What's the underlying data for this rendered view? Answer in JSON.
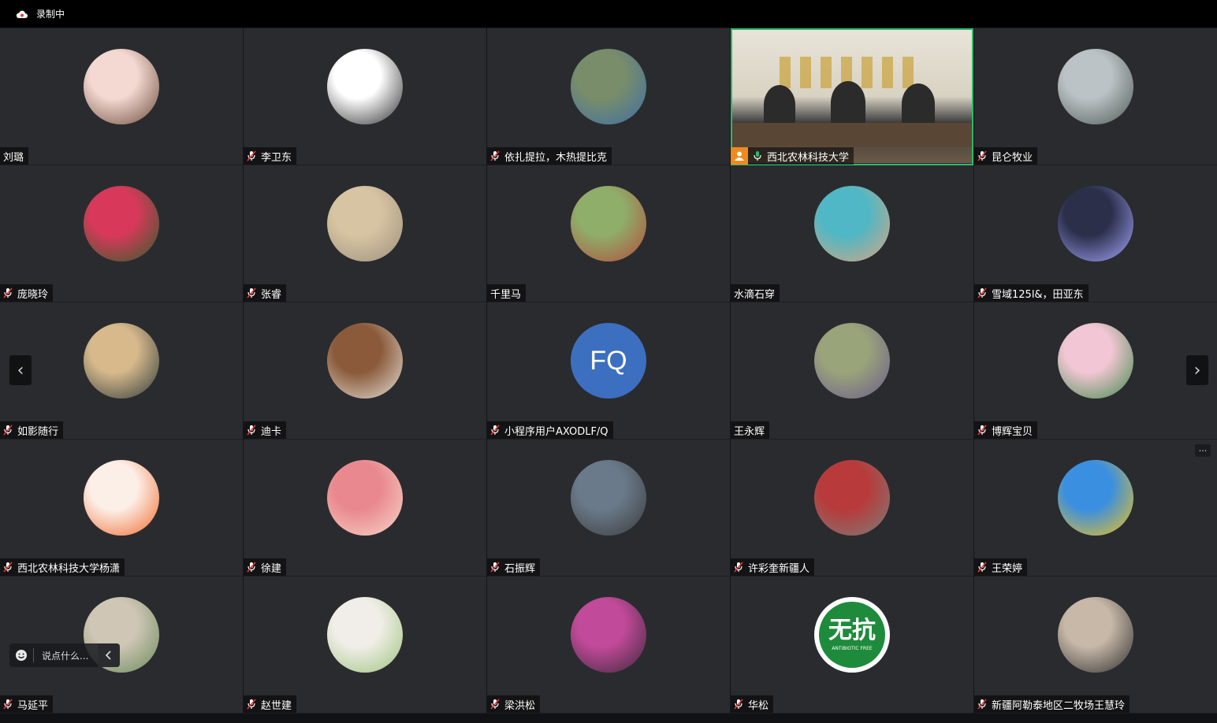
{
  "topbar": {
    "recording_label": "录制中"
  },
  "participants": [
    {
      "name": "刘璐",
      "mic": false,
      "avatar": "anime-girl-avatar",
      "colors": [
        "#f4d9d2",
        "#6b4a3a"
      ]
    },
    {
      "name": "李卫东",
      "mic": true,
      "avatar": "man-portrait-avatar",
      "colors": [
        "#ffffff",
        "#2b2b2b"
      ]
    },
    {
      "name": "依扎提拉，木热提比克",
      "mic": true,
      "avatar": "two-boys-photo-avatar",
      "colors": [
        "#7a8d6a",
        "#3d6ea5"
      ]
    },
    {
      "name": "西北农林科技大学",
      "mic": true,
      "host": true,
      "video": true,
      "avatar": "meeting-room-video"
    },
    {
      "name": "昆仑牧业",
      "mic": true,
      "avatar": "pagoda-car-photo-avatar",
      "colors": [
        "#bcc3c7",
        "#4d5a52"
      ]
    },
    {
      "name": "庞晓玲",
      "mic": true,
      "avatar": "hydrangea-photo-avatar",
      "colors": [
        "#d8395a",
        "#2f5f2a"
      ]
    },
    {
      "name": "张睿",
      "mic": true,
      "avatar": "field-photo-avatar",
      "colors": [
        "#d7c4a2",
        "#9b8f7d"
      ]
    },
    {
      "name": "千里马",
      "mic": false,
      "avatar": "garden-photo-avatar",
      "colors": [
        "#8fae6a",
        "#b34b3c"
      ]
    },
    {
      "name": "水滴石穿",
      "mic": false,
      "avatar": "seascape-photo-avatar",
      "colors": [
        "#4fb7c5",
        "#d9a57f"
      ]
    },
    {
      "name": "雪域125l&，田亚东",
      "mic": true,
      "avatar": "light-tunnel-avatar",
      "colors": [
        "#2b2f4a",
        "#a7a8ff"
      ]
    },
    {
      "name": "如影随行",
      "mic": true,
      "avatar": "sunset-lake-avatar",
      "colors": [
        "#d7b98c",
        "#2e3a3a"
      ]
    },
    {
      "name": "迪卡",
      "mic": true,
      "avatar": "horses-photo-avatar",
      "colors": [
        "#8a5a3a",
        "#e6e1d8"
      ]
    },
    {
      "name": "小程序用户AXODLF/Q",
      "mic": true,
      "initials": "FQ",
      "avatar": "initials-avatar",
      "colors": [
        "#3d6fc0",
        "#3d6fc0"
      ]
    },
    {
      "name": "王永辉",
      "mic": false,
      "avatar": "orchard-photo-avatar",
      "colors": [
        "#9aa47a",
        "#6b5c8a"
      ]
    },
    {
      "name": "博辉宝贝",
      "mic": true,
      "avatar": "blossom-photo-avatar",
      "colors": [
        "#f2c6d4",
        "#3f8a4a"
      ]
    },
    {
      "name": "西北农林科技大学杨潇",
      "mic": true,
      "avatar": "carrot-cartoon-avatar",
      "colors": [
        "#fcefe8",
        "#f06a2c"
      ]
    },
    {
      "name": "徐建",
      "mic": true,
      "avatar": "cartoon-couple-avatar",
      "colors": [
        "#e9888f",
        "#f6d7c7"
      ]
    },
    {
      "name": "石振辉",
      "mic": true,
      "avatar": "mountain-person-avatar",
      "colors": [
        "#6a7a8a",
        "#3b3b3b"
      ]
    },
    {
      "name": "许彩奎新疆人",
      "mic": true,
      "avatar": "street-banner-avatar",
      "colors": [
        "#b83a3a",
        "#7a7f7a"
      ]
    },
    {
      "name": "王荣婷",
      "mic": true,
      "avatar": "sunflower-photo-avatar",
      "colors": [
        "#3a8fe0",
        "#f2c21b"
      ]
    },
    {
      "name": "马延平",
      "mic": true,
      "avatar": "gourd-statue-avatar",
      "colors": [
        "#cfc6b6",
        "#6b8a5a"
      ]
    },
    {
      "name": "赵世建",
      "mic": true,
      "avatar": "cartoon-pig-avatar",
      "colors": [
        "#f1eee9",
        "#9cc27a"
      ]
    },
    {
      "name": "梁洪松",
      "mic": true,
      "avatar": "woman-portrait-avatar",
      "colors": [
        "#c24a9a",
        "#3a2a3a"
      ]
    },
    {
      "name": "华松",
      "mic": true,
      "avatar": "antibiotic-free-logo-avatar",
      "colors": [
        "#ffffff",
        "#1e8b3c"
      ],
      "logo_text": "无抗",
      "logo_sub": "ANTIBIOTIC FREE"
    },
    {
      "name": "新疆阿勒泰地区二牧场王慧玲",
      "mic": true,
      "avatar": "two-women-photo-avatar",
      "colors": [
        "#c7b8a8",
        "#2f2f2f"
      ]
    }
  ],
  "chat": {
    "placeholder": "说点什么..."
  },
  "nav": {
    "prev_icon": "chevron-left-icon",
    "next_icon": "chevron-right-icon"
  },
  "more": {
    "label": "···"
  }
}
